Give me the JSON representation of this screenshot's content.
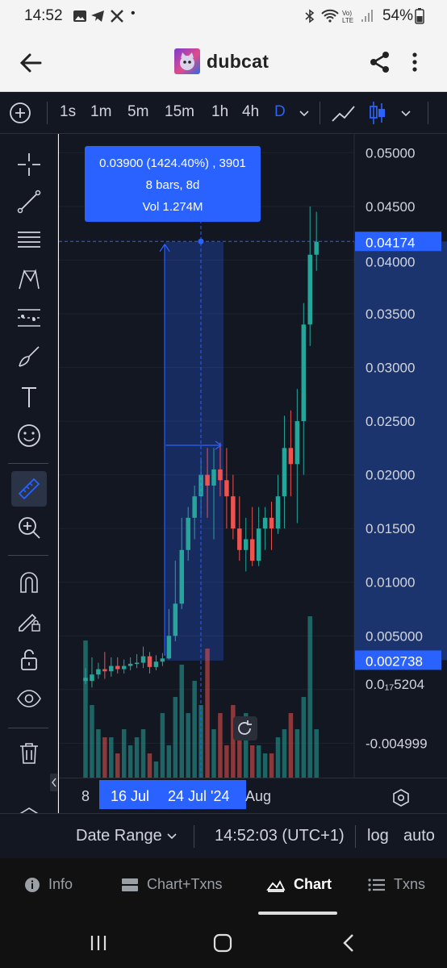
{
  "status_bar": {
    "time": "14:52",
    "dot": "•",
    "battery": "54%"
  },
  "header": {
    "title": "dubcat"
  },
  "toolbar": {
    "intervals": [
      "1s",
      "1m",
      "5m",
      "15m",
      "1h",
      "4h",
      "D"
    ],
    "active_interval": "D"
  },
  "price_axis": {
    "labels": [
      "0.05000",
      "0.04500",
      "0.04000",
      "0.03500",
      "0.03000",
      "0.02500",
      "0.02000",
      "0.01500",
      "0.01000",
      "0.005000",
      "0.0₁₇5204",
      "-0.004999"
    ],
    "current_price": "0.04174",
    "measure_price": "0.002738"
  },
  "measure_tooltip": {
    "line1": "0.03900 (1424.40%) , 3901",
    "line2": "8 bars, 8d",
    "line3": "Vol 1.274M"
  },
  "time_axis": {
    "labels": [
      "8",
      "16 Jul",
      "24 Jul '24",
      "Aug"
    ]
  },
  "bottom_bar": {
    "date_range": "Date Range",
    "clock": "14:52:03 (UTC+1)",
    "log": "log",
    "auto": "auto"
  },
  "bottom_nav": {
    "items": [
      {
        "label": "Info",
        "icon": "info-icon"
      },
      {
        "label": "Chart+Txns",
        "icon": "split-icon"
      },
      {
        "label": "Chart",
        "icon": "chart-icon"
      },
      {
        "label": "Txns",
        "icon": "list-icon"
      }
    ],
    "active": "Chart"
  },
  "chart_data": {
    "type": "candlestick",
    "x": [
      "5 Jul",
      "6 Jul",
      "7 Jul",
      "8 Jul",
      "9 Jul",
      "10 Jul",
      "11 Jul",
      "12 Jul",
      "13 Jul",
      "14 Jul",
      "15 Jul",
      "16 Jul",
      "17 Jul",
      "18 Jul",
      "19 Jul",
      "20 Jul",
      "21 Jul",
      "22 Jul",
      "23 Jul",
      "24 Jul",
      "25 Jul",
      "26 Jul",
      "27 Jul",
      "28 Jul",
      "29 Jul",
      "30 Jul",
      "31 Jul",
      "1 Aug",
      "2 Aug",
      "3 Aug",
      "4 Aug",
      "5 Aug",
      "6 Aug",
      "7 Aug",
      "8 Aug",
      "9 Aug",
      "10 Aug"
    ],
    "open": [
      0.0008,
      0.0008,
      0.0014,
      0.0019,
      0.0017,
      0.0022,
      0.0019,
      0.0022,
      0.0024,
      0.0025,
      0.0031,
      0.0021,
      0.0026,
      0.0029,
      0.005,
      0.008,
      0.013,
      0.016,
      0.018,
      0.02,
      0.019,
      0.0205,
      0.0195,
      0.018,
      0.015,
      0.013,
      0.014,
      0.012,
      0.015,
      0.016,
      0.015,
      0.018,
      0.0225,
      0.021,
      0.025,
      0.034,
      0.0405
    ],
    "close": [
      0.0011,
      0.0014,
      0.0019,
      0.0017,
      0.0022,
      0.0019,
      0.0022,
      0.0024,
      0.0025,
      0.0031,
      0.0021,
      0.0026,
      0.0029,
      0.005,
      0.008,
      0.013,
      0.016,
      0.018,
      0.02,
      0.019,
      0.0205,
      0.0195,
      0.018,
      0.015,
      0.013,
      0.014,
      0.012,
      0.015,
      0.016,
      0.015,
      0.018,
      0.0225,
      0.021,
      0.025,
      0.034,
      0.0405,
      0.0417
    ],
    "high": [
      0.002,
      0.003,
      0.0025,
      0.0035,
      0.003,
      0.003,
      0.0028,
      0.003,
      0.0033,
      0.004,
      0.0035,
      0.0032,
      0.0034,
      0.0075,
      0.012,
      0.016,
      0.017,
      0.019,
      0.0215,
      0.0225,
      0.0225,
      0.023,
      0.0225,
      0.02,
      0.018,
      0.016,
      0.017,
      0.017,
      0.017,
      0.0175,
      0.02,
      0.0255,
      0.026,
      0.028,
      0.036,
      0.045,
      0.0445
    ],
    "low": [
      0.0005,
      0.0002,
      0.001,
      0.001,
      0.0012,
      0.0015,
      0.0015,
      0.0018,
      0.002,
      0.002,
      0.0015,
      0.0018,
      0.0022,
      0.0028,
      0.0045,
      0.0075,
      0.012,
      0.014,
      0.016,
      0.016,
      0.014,
      0.018,
      0.015,
      0.014,
      0.012,
      0.011,
      0.0115,
      0.0115,
      0.013,
      0.013,
      0.0145,
      0.015,
      0.018,
      0.0155,
      0.02,
      0.032,
      0.039
    ],
    "volume_relative": [
      0.85,
      0.45,
      0.3,
      0.25,
      0.25,
      0.15,
      0.3,
      0.2,
      0.25,
      0.3,
      0.15,
      0.1,
      0.4,
      0.2,
      0.5,
      0.7,
      0.4,
      0.6,
      0.45,
      0.8,
      0.3,
      0.4,
      0.2,
      0.45,
      0.35,
      0.4,
      0.2,
      0.2,
      0.15,
      0.15,
      0.25,
      0.3,
      0.4,
      0.3,
      0.5,
      1.0,
      0.3
    ],
    "measure": {
      "from_price": 0.0027,
      "to_price": 0.0417,
      "bars": 8
    },
    "y_range": [
      -0.007,
      0.051
    ]
  }
}
